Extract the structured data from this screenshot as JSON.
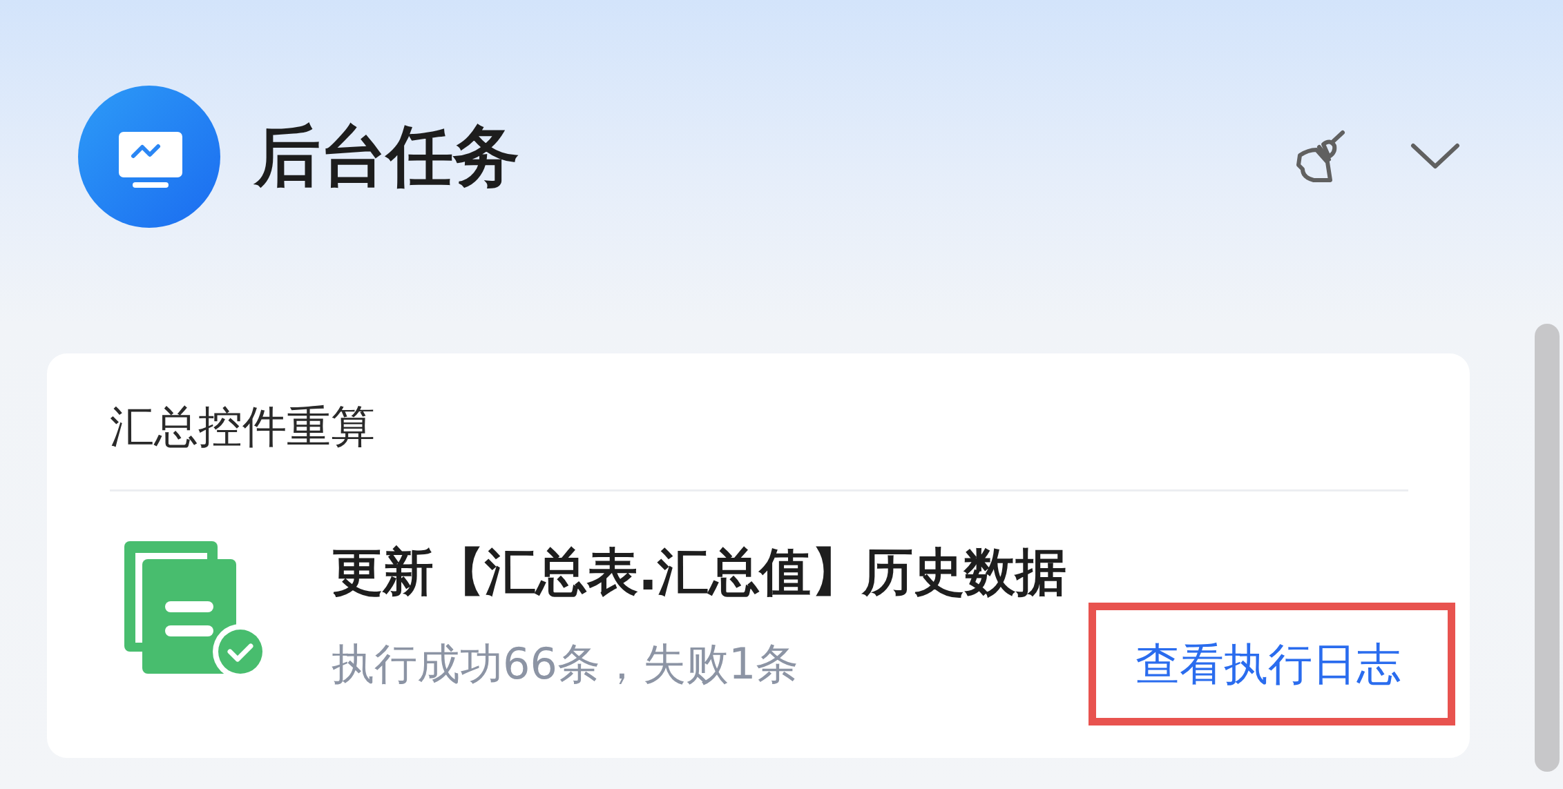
{
  "header": {
    "title": "后台任务"
  },
  "card": {
    "title": "汇总控件重算",
    "task": {
      "succeeded": true,
      "title": "更新【汇总表.汇总值】历史数据",
      "summary": "执行成功66条，失败1条",
      "link": {
        "label": "查看执行日志",
        "highlighted": true
      }
    }
  }
}
